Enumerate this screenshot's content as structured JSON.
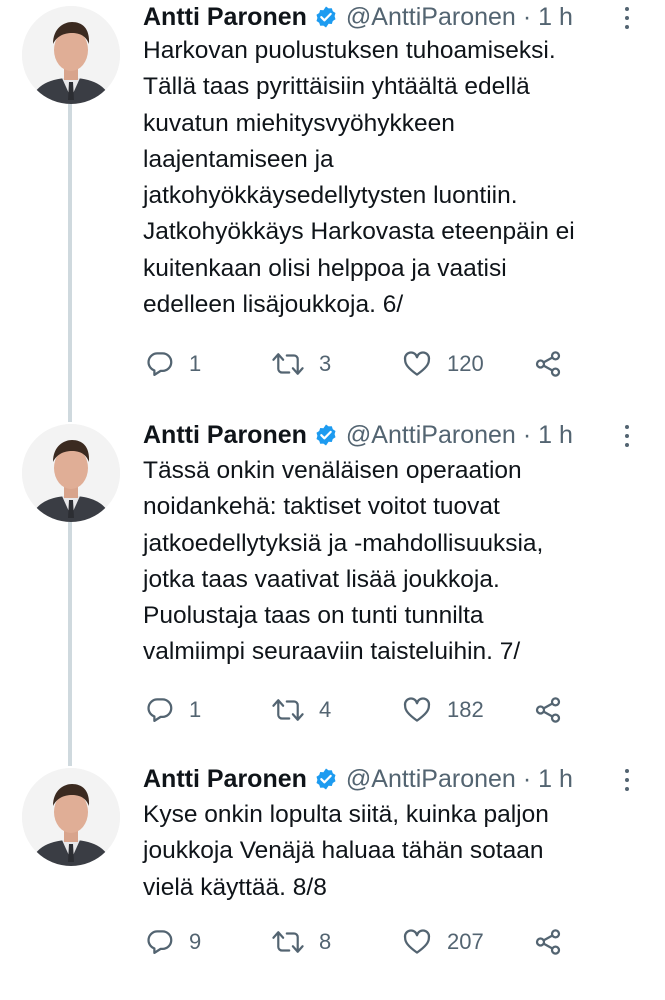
{
  "tweets": [
    {
      "author": {
        "name": "Antti Paronen",
        "handle": "@AnttiParonen",
        "time": "1 h",
        "separator": "·"
      },
      "lines": [
        "Harkovan puolustuksen tuhoamiseksi.",
        "Tällä taas pyrittäisiin yhtäältä edellä",
        "kuvatun miehitysvyöhykkeen",
        "laajentamiseen ja",
        "jatkohyökkäysedellytysten luontiin.",
        "Jatkohyökkäys Harkovasta eteenpäin ei",
        "kuitenkaan olisi helppoa ja vaatisi",
        "edelleen lisäjoukkoja. 6/"
      ],
      "stats": {
        "replies": "1",
        "retweets": "3",
        "likes": "120"
      }
    },
    {
      "author": {
        "name": "Antti Paronen",
        "handle": "@AnttiParonen",
        "time": "1 h",
        "separator": "·"
      },
      "lines": [
        "Tässä onkin venäläisen operaation",
        "noidankehä: taktiset voitot tuovat",
        "jatkoedellytyksiä ja -mahdollisuuksia,",
        "jotka taas vaativat lisää joukkoja.",
        "Puolustaja taas on tunti tunnilta",
        "valmiimpi seuraaviin taisteluihin. 7/"
      ],
      "stats": {
        "replies": "1",
        "retweets": "4",
        "likes": "182"
      }
    },
    {
      "author": {
        "name": "Antti Paronen",
        "handle": "@AnttiParonen",
        "time": "1 h",
        "separator": "·"
      },
      "lines": [
        "Kyse onkin lopulta siitä, kuinka paljon",
        "joukkoja Venäjä haluaa tähän sotaan",
        "vielä käyttää. 8/8"
      ],
      "stats": {
        "replies": "9",
        "retweets": "8",
        "likes": "207"
      }
    }
  ],
  "icons": {
    "verified": "verified-badge-icon",
    "more": "more-options-icon",
    "reply": "reply-icon",
    "retweet": "retweet-icon",
    "like": "like-icon",
    "share": "share-icon"
  },
  "colors": {
    "verified": "#1d9bf0",
    "secondary": "#536471",
    "thread_line": "#cfd9de"
  }
}
